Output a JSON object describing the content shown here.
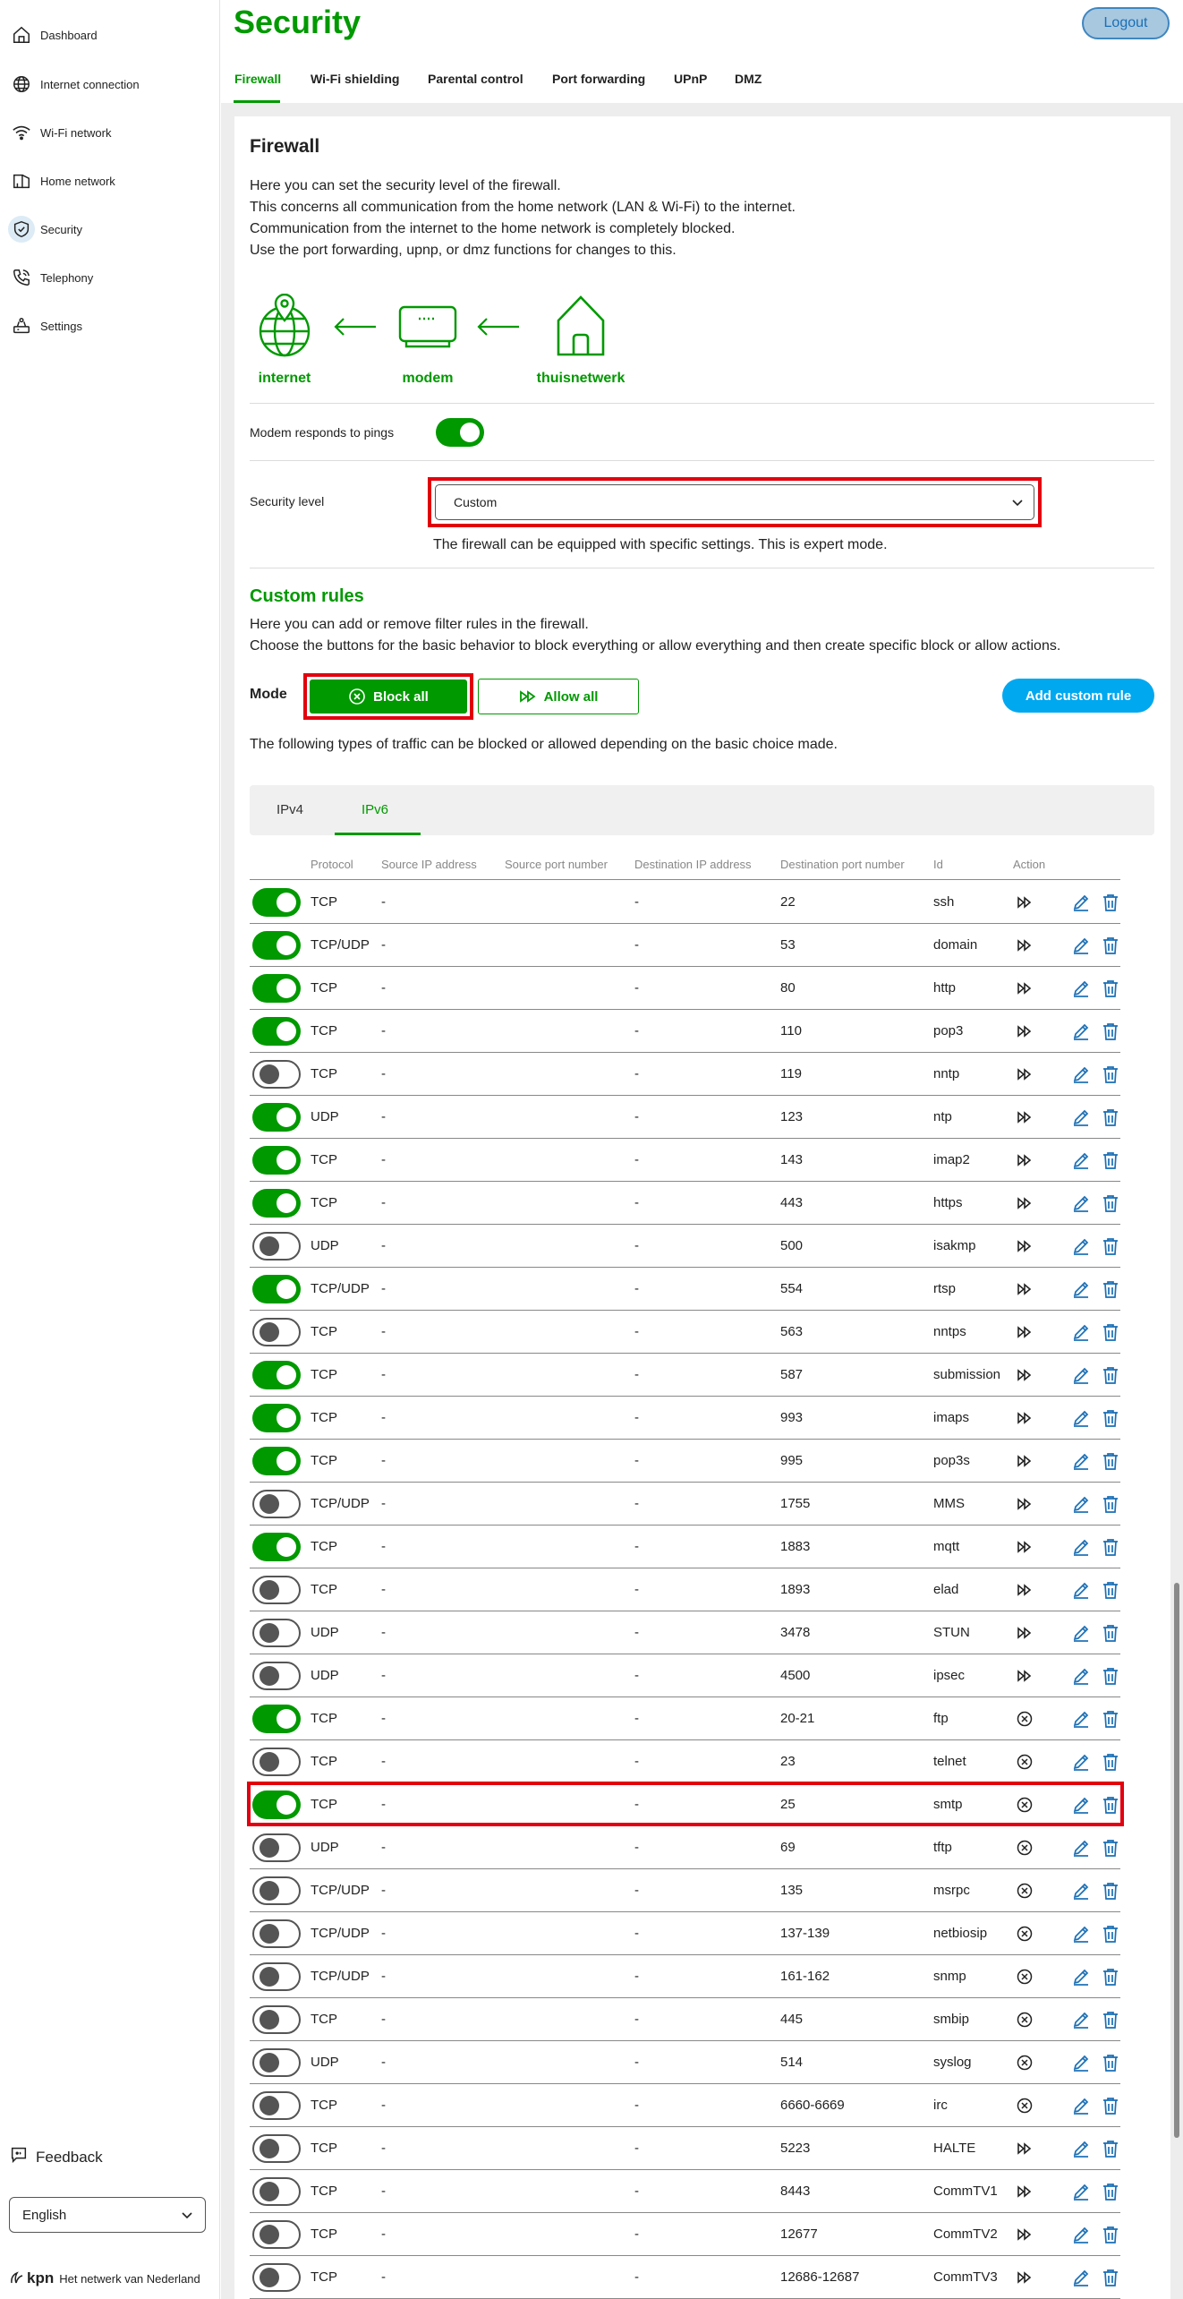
{
  "sidebar": {
    "items": [
      {
        "label": "Dashboard",
        "icon": "home-icon"
      },
      {
        "label": "Internet connection",
        "icon": "globe-icon"
      },
      {
        "label": "Wi-Fi network",
        "icon": "wifi-icon"
      },
      {
        "label": "Home network",
        "icon": "home-network-icon"
      },
      {
        "label": "Security",
        "icon": "shield-icon",
        "active": true
      },
      {
        "label": "Telephony",
        "icon": "phone-icon"
      },
      {
        "label": "Settings",
        "icon": "router-settings-icon"
      }
    ],
    "feedback": "Feedback",
    "language": "English",
    "brand": "kpn",
    "slogan": "Het netwerk van Nederland"
  },
  "header": {
    "title": "Security",
    "logout": "Logout",
    "tabs": [
      "Firewall",
      "Wi-Fi shielding",
      "Parental control",
      "Port forwarding",
      "UPnP",
      "DMZ"
    ]
  },
  "firewall": {
    "heading": "Firewall",
    "desc": [
      "Here you can set the security level of the firewall.",
      "This concerns all communication from the home network (LAN & Wi-Fi) to the internet.",
      "Communication from the internet to the home network is completely blocked.",
      "Use the port forwarding, upnp, or dmz functions for changes to this."
    ],
    "diagram": {
      "internet": "internet",
      "modem": "modem",
      "home": "thuisnetwerk"
    },
    "ping_label": "Modem responds to pings",
    "ping_on": true,
    "security_level_label": "Security level",
    "security_level_value": "Custom",
    "security_note": "The firewall can be equipped with specific settings. This is expert mode."
  },
  "custom_rules": {
    "heading": "Custom rules",
    "desc": [
      "Here you can add or remove filter rules in the firewall.",
      "Choose the buttons for the basic behavior to block everything or allow everything and then create specific block or allow actions."
    ],
    "mode_label": "Mode",
    "block_all": "Block all",
    "allow_all": "Allow all",
    "add_rule": "Add custom rule",
    "traffic_note": "The following types of traffic can be blocked or allowed depending on the basic choice made.",
    "ip_tabs": [
      "IPv4",
      "IPv6"
    ],
    "active_ip_tab": "IPv6",
    "columns": [
      "Protocol",
      "Source IP address",
      "Source port number",
      "Destination IP address",
      "Destination port number",
      "Id",
      "Action"
    ],
    "rows": [
      {
        "on": true,
        "protocol": "TCP",
        "src_ip": "-",
        "dst_ip": "-",
        "port": "22",
        "id": "ssh",
        "action": "allow"
      },
      {
        "on": true,
        "protocol": "TCP/UDP",
        "src_ip": "-",
        "dst_ip": "-",
        "port": "53",
        "id": "domain",
        "action": "allow"
      },
      {
        "on": true,
        "protocol": "TCP",
        "src_ip": "-",
        "dst_ip": "-",
        "port": "80",
        "id": "http",
        "action": "allow"
      },
      {
        "on": true,
        "protocol": "TCP",
        "src_ip": "-",
        "dst_ip": "-",
        "port": "110",
        "id": "pop3",
        "action": "allow"
      },
      {
        "on": false,
        "protocol": "TCP",
        "src_ip": "-",
        "dst_ip": "-",
        "port": "119",
        "id": "nntp",
        "action": "allow"
      },
      {
        "on": true,
        "protocol": "UDP",
        "src_ip": "-",
        "dst_ip": "-",
        "port": "123",
        "id": "ntp",
        "action": "allow"
      },
      {
        "on": true,
        "protocol": "TCP",
        "src_ip": "-",
        "dst_ip": "-",
        "port": "143",
        "id": "imap2",
        "action": "allow"
      },
      {
        "on": true,
        "protocol": "TCP",
        "src_ip": "-",
        "dst_ip": "-",
        "port": "443",
        "id": "https",
        "action": "allow"
      },
      {
        "on": false,
        "protocol": "UDP",
        "src_ip": "-",
        "dst_ip": "-",
        "port": "500",
        "id": "isakmp",
        "action": "allow"
      },
      {
        "on": true,
        "protocol": "TCP/UDP",
        "src_ip": "-",
        "dst_ip": "-",
        "port": "554",
        "id": "rtsp",
        "action": "allow"
      },
      {
        "on": false,
        "protocol": "TCP",
        "src_ip": "-",
        "dst_ip": "-",
        "port": "563",
        "id": "nntps",
        "action": "allow"
      },
      {
        "on": true,
        "protocol": "TCP",
        "src_ip": "-",
        "dst_ip": "-",
        "port": "587",
        "id": "submission",
        "action": "allow"
      },
      {
        "on": true,
        "protocol": "TCP",
        "src_ip": "-",
        "dst_ip": "-",
        "port": "993",
        "id": "imaps",
        "action": "allow"
      },
      {
        "on": true,
        "protocol": "TCP",
        "src_ip": "-",
        "dst_ip": "-",
        "port": "995",
        "id": "pop3s",
        "action": "allow"
      },
      {
        "on": false,
        "protocol": "TCP/UDP",
        "src_ip": "-",
        "dst_ip": "-",
        "port": "1755",
        "id": "MMS",
        "action": "allow"
      },
      {
        "on": true,
        "protocol": "TCP",
        "src_ip": "-",
        "dst_ip": "-",
        "port": "1883",
        "id": "mqtt",
        "action": "allow"
      },
      {
        "on": false,
        "protocol": "TCP",
        "src_ip": "-",
        "dst_ip": "-",
        "port": "1893",
        "id": "elad",
        "action": "allow"
      },
      {
        "on": false,
        "protocol": "UDP",
        "src_ip": "-",
        "dst_ip": "-",
        "port": "3478",
        "id": "STUN",
        "action": "allow"
      },
      {
        "on": false,
        "protocol": "UDP",
        "src_ip": "-",
        "dst_ip": "-",
        "port": "4500",
        "id": "ipsec",
        "action": "allow"
      },
      {
        "on": true,
        "protocol": "TCP",
        "src_ip": "-",
        "dst_ip": "-",
        "port": "20-21",
        "id": "ftp",
        "action": "block"
      },
      {
        "on": false,
        "protocol": "TCP",
        "src_ip": "-",
        "dst_ip": "-",
        "port": "23",
        "id": "telnet",
        "action": "block"
      },
      {
        "on": true,
        "protocol": "TCP",
        "src_ip": "-",
        "dst_ip": "-",
        "port": "25",
        "id": "smtp",
        "action": "block",
        "highlight": true
      },
      {
        "on": false,
        "protocol": "UDP",
        "src_ip": "-",
        "dst_ip": "-",
        "port": "69",
        "id": "tftp",
        "action": "block"
      },
      {
        "on": false,
        "protocol": "TCP/UDP",
        "src_ip": "-",
        "dst_ip": "-",
        "port": "135",
        "id": "msrpc",
        "action": "block"
      },
      {
        "on": false,
        "protocol": "TCP/UDP",
        "src_ip": "-",
        "dst_ip": "-",
        "port": "137-139",
        "id": "netbiosip",
        "action": "block"
      },
      {
        "on": false,
        "protocol": "TCP/UDP",
        "src_ip": "-",
        "dst_ip": "-",
        "port": "161-162",
        "id": "snmp",
        "action": "block"
      },
      {
        "on": false,
        "protocol": "TCP",
        "src_ip": "-",
        "dst_ip": "-",
        "port": "445",
        "id": "smbip",
        "action": "block"
      },
      {
        "on": false,
        "protocol": "UDP",
        "src_ip": "-",
        "dst_ip": "-",
        "port": "514",
        "id": "syslog",
        "action": "block"
      },
      {
        "on": false,
        "protocol": "TCP",
        "src_ip": "-",
        "dst_ip": "-",
        "port": "6660-6669",
        "id": "irc",
        "action": "block"
      },
      {
        "on": false,
        "protocol": "TCP",
        "src_ip": "-",
        "dst_ip": "-",
        "port": "5223",
        "id": "HALTE",
        "action": "allow"
      },
      {
        "on": false,
        "protocol": "TCP",
        "src_ip": "-",
        "dst_ip": "-",
        "port": "8443",
        "id": "CommTV1",
        "action": "allow"
      },
      {
        "on": false,
        "protocol": "TCP",
        "src_ip": "-",
        "dst_ip": "-",
        "port": "12677",
        "id": "CommTV2",
        "action": "allow"
      },
      {
        "on": false,
        "protocol": "TCP",
        "src_ip": "-",
        "dst_ip": "-",
        "port": "12686-12687",
        "id": "CommTV3",
        "action": "allow"
      }
    ]
  },
  "colors": {
    "green": "#009900",
    "blue": "#1a6fb5",
    "red": "#e2000f",
    "add_button": "#00a8f0"
  }
}
